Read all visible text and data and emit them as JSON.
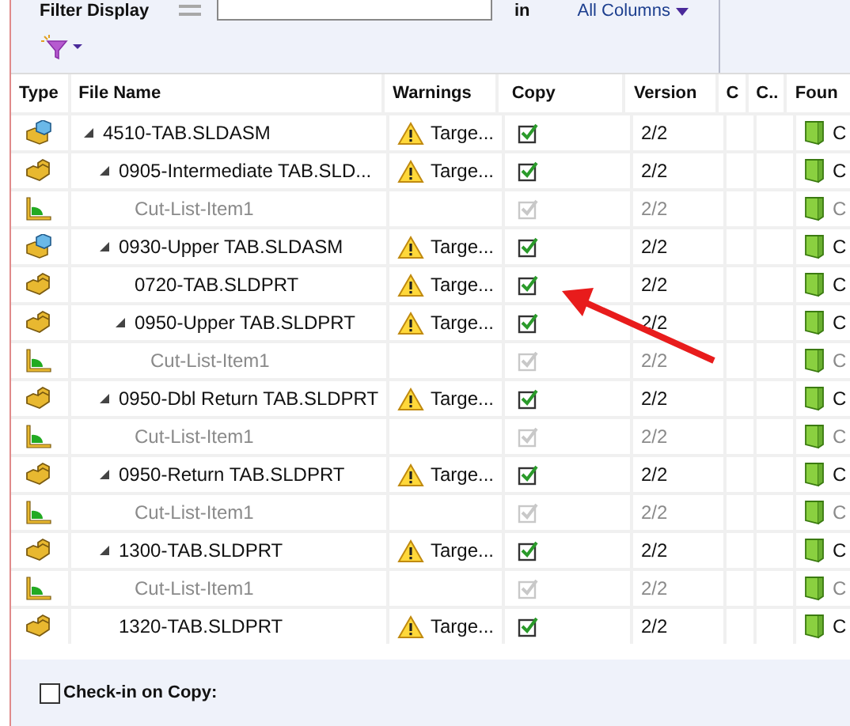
{
  "filter": {
    "label": "Filter Display",
    "in_label": "in",
    "scope": "All Columns"
  },
  "table": {
    "columns": [
      "Type",
      "File Name",
      "Warnings",
      "Copy",
      "Version",
      "C",
      "C..",
      "Foun"
    ],
    "rows": [
      {
        "kind": "assembly",
        "name": "4510-TAB.SLDASM",
        "expanded": true,
        "disabled": false,
        "warning": "Targe...",
        "copy_checked": true,
        "version": "2/2",
        "found": "C",
        "children": [
          {
            "kind": "part",
            "name": "0905-Intermediate TAB.SLD...",
            "expanded": true,
            "disabled": false,
            "warning": "Targe...",
            "copy_checked": true,
            "version": "2/2",
            "found": "C",
            "children": [
              {
                "kind": "cutlist",
                "name": "Cut-List-Item1",
                "disabled": true,
                "copy_checked": true,
                "version": "2/2",
                "found": "C"
              }
            ]
          },
          {
            "kind": "assembly",
            "name": "0930-Upper TAB.SLDASM",
            "expanded": true,
            "disabled": false,
            "warning": "Targe...",
            "copy_checked": true,
            "version": "2/2",
            "found": "C",
            "children": [
              {
                "kind": "part",
                "name": "0720-TAB.SLDPRT",
                "disabled": false,
                "warning": "Targe...",
                "copy_checked": true,
                "version": "2/2",
                "found": "C"
              },
              {
                "kind": "part",
                "name": "0950-Upper TAB.SLDPRT",
                "expanded": true,
                "disabled": false,
                "warning": "Targe...",
                "copy_checked": true,
                "version": "2/2",
                "found": "C",
                "children": [
                  {
                    "kind": "cutlist",
                    "name": "Cut-List-Item1",
                    "disabled": true,
                    "copy_checked": true,
                    "version": "2/2",
                    "found": "C"
                  }
                ]
              }
            ]
          },
          {
            "kind": "part",
            "name": "0950-Dbl Return TAB.SLDPRT",
            "expanded": true,
            "disabled": false,
            "warning": "Targe...",
            "copy_checked": true,
            "version": "2/2",
            "found": "C",
            "children": [
              {
                "kind": "cutlist",
                "name": "Cut-List-Item1",
                "disabled": true,
                "copy_checked": true,
                "version": "2/2",
                "found": "C"
              }
            ]
          },
          {
            "kind": "part",
            "name": "0950-Return TAB.SLDPRT",
            "expanded": true,
            "disabled": false,
            "warning": "Targe...",
            "copy_checked": true,
            "version": "2/2",
            "found": "C",
            "children": [
              {
                "kind": "cutlist",
                "name": "Cut-List-Item1",
                "disabled": true,
                "copy_checked": true,
                "version": "2/2",
                "found": "C"
              }
            ]
          },
          {
            "kind": "part",
            "name": "1300-TAB.SLDPRT",
            "expanded": true,
            "disabled": false,
            "warning": "Targe...",
            "copy_checked": true,
            "version": "2/2",
            "found": "C",
            "children": [
              {
                "kind": "cutlist",
                "name": "Cut-List-Item1",
                "disabled": true,
                "copy_checked": true,
                "version": "2/2",
                "found": "C"
              }
            ]
          },
          {
            "kind": "part",
            "name": "1320-TAB.SLDPRT",
            "disabled": false,
            "warning": "Targe...",
            "copy_checked": true,
            "version": "2/2",
            "found": "C"
          }
        ]
      }
    ]
  },
  "checkin_on_copy": {
    "label": "Check-in on Copy:",
    "checked": false
  }
}
